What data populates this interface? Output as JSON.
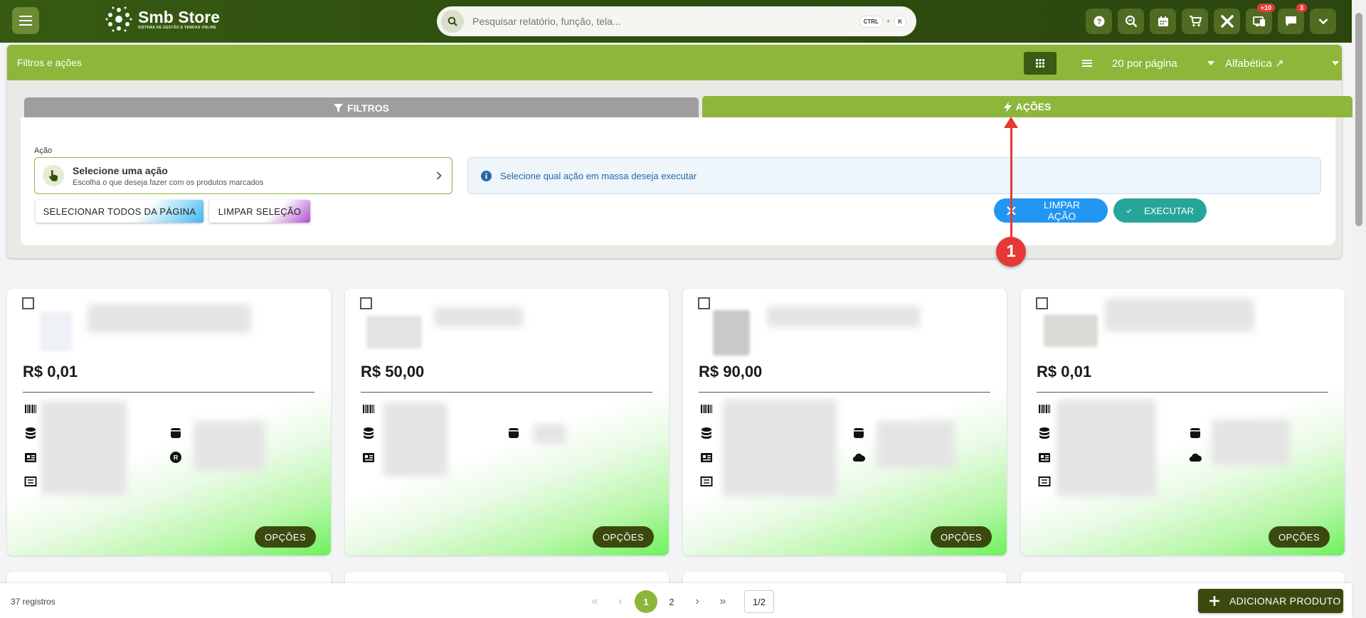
{
  "app": {
    "logo_text": "Smb Store",
    "logo_subtitle": "SISTEMA DE GESTÃO E VENDAS ONLINE"
  },
  "search": {
    "placeholder": "Pesquisar relatório, função, tela...",
    "shortcut_key1": "CTRL",
    "shortcut_plus": "+",
    "shortcut_key2": "K"
  },
  "header_icons": [
    {
      "name": "help-icon"
    },
    {
      "name": "zoom-icon"
    },
    {
      "name": "calendar-icon"
    },
    {
      "name": "cart-icon"
    },
    {
      "name": "tools-icon"
    },
    {
      "name": "notifications-icon",
      "badge": "+10"
    },
    {
      "name": "messages-icon",
      "badge": "3"
    },
    {
      "name": "chevron-down-icon"
    }
  ],
  "panel": {
    "title": "Filtros e ações",
    "per_page": "20 por página",
    "sort": "Alfabética ↗",
    "tabs": {
      "filtros": "FILTROS",
      "acoes": "AÇÕES"
    },
    "acao_label": "Ação",
    "acao_title": "Selecione uma ação",
    "acao_sub": "Escolha o que deseja fazer com os produtos marcados",
    "info_text": "Selecione qual ação em massa deseja executar",
    "btn_select_all": "SELECIONAR TODOS DA PÁGINA",
    "btn_clear_selection": "LIMPAR SELEÇÃO",
    "btn_clear_action": "LIMPAR AÇÃO",
    "btn_execute": "EXECUTAR"
  },
  "annotation": {
    "marker": "1",
    "color": "#e53935"
  },
  "products": [
    {
      "price": "R$ 0,01",
      "options_label": "OPÇÕES"
    },
    {
      "price": "R$ 50,00",
      "options_label": "OPÇÕES"
    },
    {
      "price": "R$ 90,00",
      "options_label": "OPÇÕES"
    },
    {
      "price": "R$ 0,01",
      "options_label": "OPÇÕES"
    }
  ],
  "footer": {
    "records": "37 registros",
    "pages": [
      "1",
      "2"
    ],
    "current_page": "1",
    "page_indicator": "1/2",
    "add_product": "ADICIONAR PRODUTO"
  },
  "colors": {
    "primary_dark": "#2f4f10",
    "accent_green": "#8db63a",
    "button_dark": "#3a4a0e",
    "blue": "#2196f3",
    "teal": "#26a69a"
  }
}
